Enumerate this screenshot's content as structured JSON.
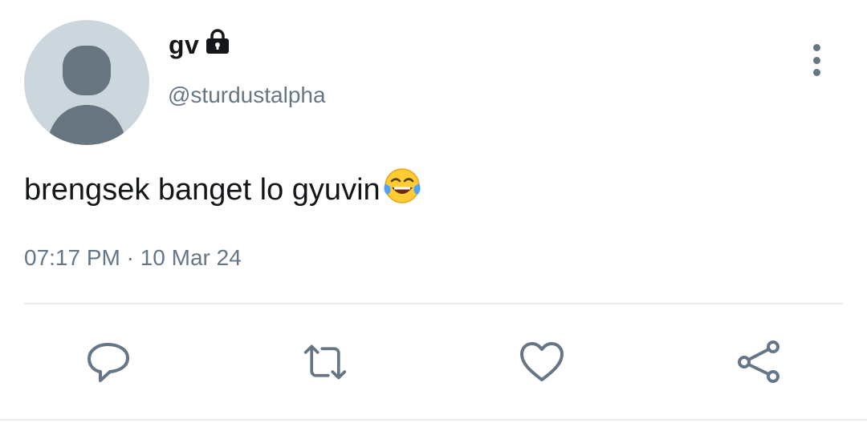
{
  "author": {
    "display_name": "gv",
    "handle": "@sturdustalpha",
    "protected_icon": "lock-icon",
    "avatar": "default-avatar"
  },
  "tweet": {
    "text": "brengsek banget lo gyuvin",
    "emoji": "tears-of-joy-emoji",
    "timestamp": "07:17 PM · 10 Mar 24"
  },
  "menu": {
    "icon": "more-vertical-icon"
  },
  "actions": [
    {
      "name": "reply",
      "icon": "reply-icon"
    },
    {
      "name": "retweet",
      "icon": "retweet-icon"
    },
    {
      "name": "like",
      "icon": "heart-icon"
    },
    {
      "name": "share",
      "icon": "share-icon"
    }
  ],
  "colors": {
    "text_primary": "#14171a",
    "text_secondary": "#657786",
    "avatar_bg": "#ccd6dd",
    "avatar_fg": "#66757f",
    "divider": "#e6ecf0"
  }
}
